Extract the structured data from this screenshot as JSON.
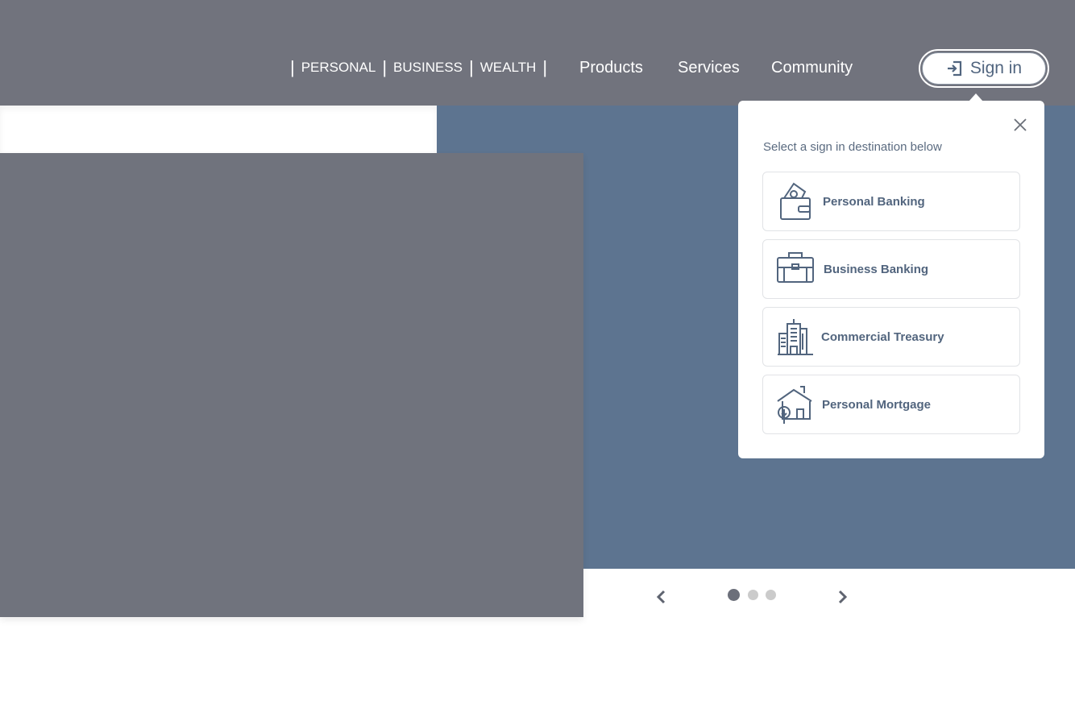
{
  "header": {
    "segments": [
      "PERSONAL",
      "BUSINESS",
      "WEALTH"
    ],
    "nav": [
      "Products",
      "Services",
      "Community"
    ],
    "signin_label": "Sign in"
  },
  "popup": {
    "title": "Select a sign in destination below",
    "options": [
      {
        "label": "Personal Banking",
        "icon": "wallet-icon"
      },
      {
        "label": "Business Banking",
        "icon": "briefcase-icon"
      },
      {
        "label": "Commercial Treasury",
        "icon": "building-icon"
      },
      {
        "label": "Personal Mortgage",
        "icon": "house-icon"
      }
    ]
  },
  "carousel": {
    "slides": 3,
    "active": 1
  },
  "colors": {
    "header": "#71737d",
    "hero": "#5d7490",
    "accent": "#51657f"
  }
}
